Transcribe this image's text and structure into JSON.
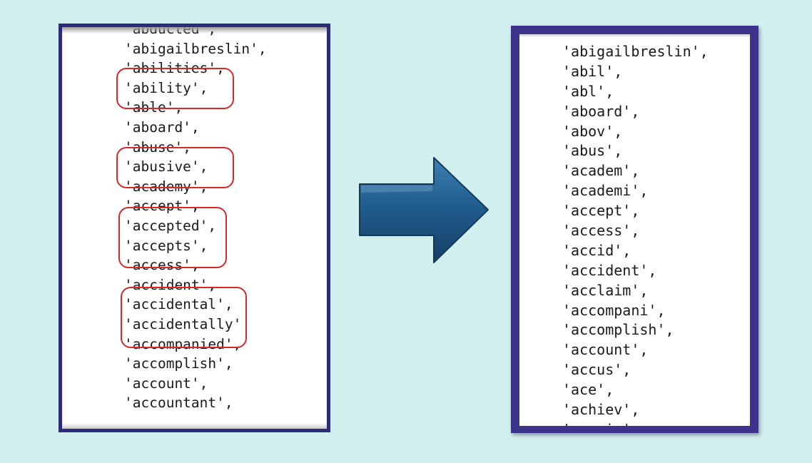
{
  "left_panel": {
    "words": [
      "'abducted',",
      "'abigailbreslin',",
      "'abilities',",
      "'ability',",
      "'able',",
      "'aboard',",
      "'abuse',",
      "'abusive',",
      "'academy',",
      "'accept',",
      "'accepted',",
      "'accepts',",
      "'access',",
      "'accident',",
      "'accidental',",
      "'accidentally'",
      "'accompanied',",
      "'accomplish',",
      "'account',",
      "'accountant',"
    ]
  },
  "right_panel": {
    "words": [
      "'abigailbreslin',",
      "'abil',",
      "'abl',",
      "'aboard',",
      "'abov',",
      "'abus',",
      "'academ',",
      "'academi',",
      "'accept',",
      "'access',",
      "'accid',",
      "'accident',",
      "'acclaim',",
      "'accompani',",
      "'accomplish',",
      "'account',",
      "'accus',",
      "'ace',",
      "'achiev',",
      "'acquir',"
    ]
  },
  "colors": {
    "background": "#d2eff0",
    "panel_border": "#2e2a7a",
    "highlight_circle": "#d42a2a",
    "arrow": "#1f5a8a"
  },
  "icons": {
    "arrow": "right-arrow-icon"
  }
}
